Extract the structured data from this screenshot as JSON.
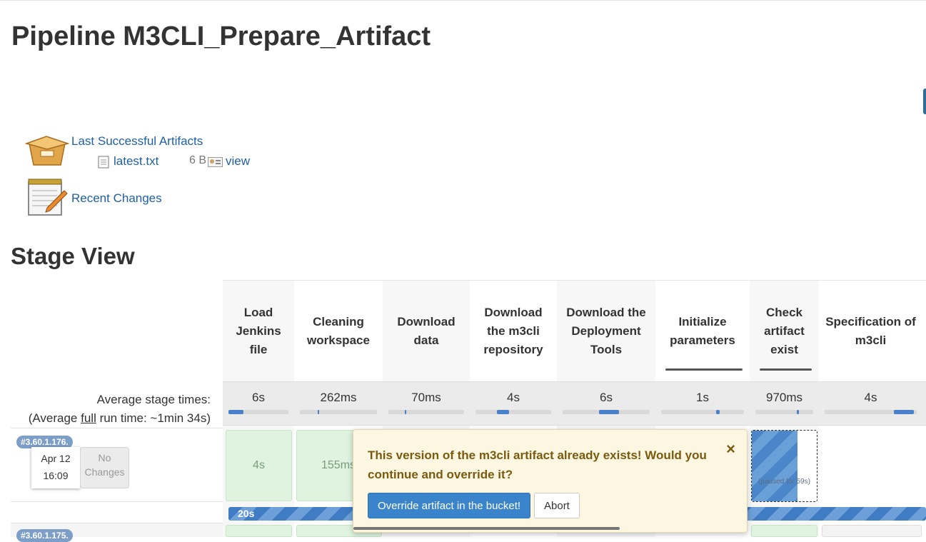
{
  "page": {
    "title": "Pipeline M3CLI_Prepare_Artifact",
    "artifacts_link": "Last Successful Artifacts",
    "file_name": "latest.txt",
    "file_size": "6 B",
    "view_label": "view",
    "recent_changes": "Recent Changes",
    "stage_view_title": "Stage View"
  },
  "stages": [
    {
      "name": "Load Jenkins file",
      "avg": "6s",
      "bar": [
        0.0,
        0.25
      ]
    },
    {
      "name": "Cleaning workspace",
      "avg": "262ms",
      "bar": [
        0.23,
        0.25
      ]
    },
    {
      "name": "Download data",
      "avg": "70ms",
      "bar": [
        0.22,
        0.24
      ]
    },
    {
      "name": "Download the m3cli repository",
      "avg": "4s",
      "bar": [
        0.28,
        0.44
      ]
    },
    {
      "name": "Download the Deployment Tools",
      "avg": "6s",
      "bar": [
        0.42,
        0.65
      ]
    },
    {
      "name": "Initialize parameters",
      "avg": "1s",
      "bar": [
        0.66,
        0.71
      ]
    },
    {
      "name": "Check artifact exist",
      "avg": "970ms",
      "bar": [
        0.72,
        0.75
      ]
    },
    {
      "name": "Specification of m3cli",
      "avg": "4s",
      "bar": [
        0.75,
        0.97
      ]
    }
  ],
  "avg_labels": {
    "line1": "Average stage times:",
    "prefix": "(Average ",
    "link": "full",
    "suffix": " run time: ~1min 34s)"
  },
  "run": {
    "badge": "#3.60.1.176.",
    "date": "Apr 12",
    "time": "16:09",
    "no_changes": "No Changes",
    "cells": [
      "4s",
      "155ms"
    ],
    "paused": "(paused for 59s)",
    "progress_label": "20s"
  },
  "run2": {
    "badge": "#3.60.1.175."
  },
  "popup": {
    "message": "This version of the m3cli artifact already exists! Would you continue and override it?",
    "close": "×",
    "override_btn": "Override artifact in the bucket!",
    "abort_btn": "Abort"
  },
  "icons": [
    "package-icon",
    "file-icon",
    "view-icon",
    "notepad-icon",
    "close-icon"
  ],
  "colors": {
    "link": "#1f5fa6",
    "success": "#dff3df",
    "progress": "#3f7cc3",
    "popup_bg": "#fdf7e1",
    "popup_text": "#7a5a10"
  }
}
